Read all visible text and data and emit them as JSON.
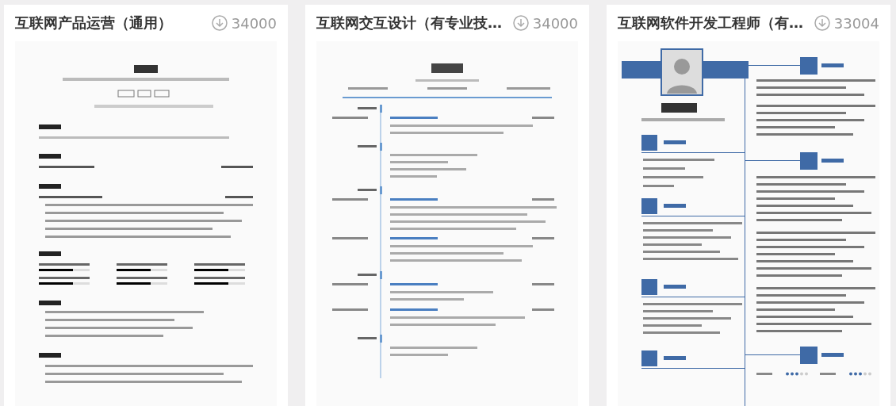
{
  "cards": [
    {
      "title": "互联网产品运营（通用）",
      "downloads": "34000",
      "kind": "plain"
    },
    {
      "title": "互联网交互设计（有专业技…",
      "downloads": "34000",
      "kind": "timeline"
    },
    {
      "title": "互联网软件开发工程师（有…",
      "downloads": "33004",
      "kind": "sidebar"
    }
  ]
}
